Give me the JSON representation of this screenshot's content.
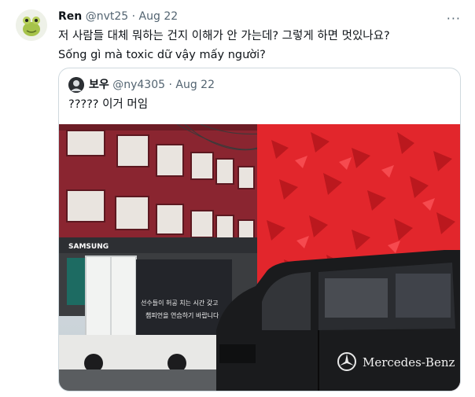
{
  "tweet": {
    "author_name": "Ren",
    "author_handle": "@nvt25",
    "separator": "·",
    "date": "Aug 22",
    "more_label": "···",
    "text_line1": "저 사람들 대체 뭐하는 건지 이해가 안 가는데? 그렇게 하면 멋있나요?",
    "text_line2": "Sống gì mà toxic dữ vậy mấy người?"
  },
  "quoted": {
    "author_name": "보우",
    "author_handle": "@ny4305",
    "separator": "·",
    "date": "Aug 22",
    "text": "????? 이거 머임",
    "photo": {
      "store_sign": "SAMSUNG",
      "truck_line1": "선수들이 허공 치는 시간 갖고",
      "truck_line2": "챔피언을 연습하기 바랍니다",
      "van_brand": "Mercedes-Benz"
    }
  },
  "colors": {
    "text_primary": "#0f1419",
    "text_secondary": "#536471",
    "border": "#cfd9de",
    "red_facade": "#e2262c",
    "brick": "#8a2530"
  }
}
